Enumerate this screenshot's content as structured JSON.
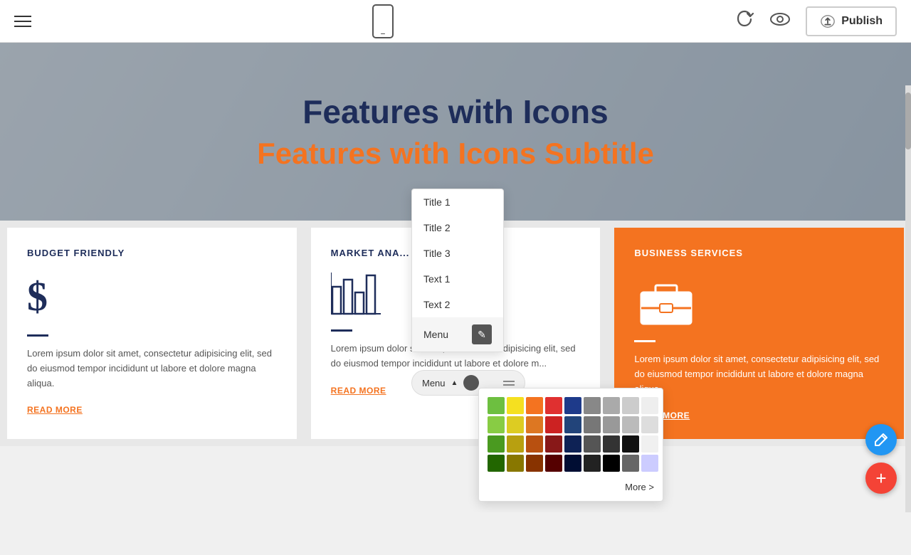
{
  "toolbar": {
    "publish_label": "Publish"
  },
  "hero": {
    "title": "Features with Icons",
    "subtitle": "Features with Icons Subtitle"
  },
  "cards": [
    {
      "id": "budget",
      "title": "BUDGET FRIENDLY",
      "icon_type": "dollar",
      "text": "Lorem ipsum dolor sit amet, consectetur adipisicing elit, sed do eiusmod tempor incididunt ut labore et dolore magna aliqua.",
      "link": "READ MORE",
      "orange": false
    },
    {
      "id": "market",
      "title": "MARKET ANA...",
      "icon_type": "chart",
      "text": "Lorem ipsum dolor sit amet, consectetur adipisicing elit, sed do eiusmod tempor incididunt ut labore et dolore m...",
      "link": "READ MORE",
      "orange": false
    },
    {
      "id": "business",
      "title": "BUSINESS SERVICES",
      "icon_type": "briefcase",
      "text": "Lorem ipsum dolor sit amet, consectetur adipisicing elit, sed do eiusmod tempor incididunt ut labore et dolore magna aliqua.",
      "link": "READ MORE",
      "orange": true
    }
  ],
  "dropdown": {
    "items": [
      {
        "label": "Title 1"
      },
      {
        "label": "Title 2"
      },
      {
        "label": "Title 3"
      },
      {
        "label": "Text 1"
      },
      {
        "label": "Text 2"
      },
      {
        "label": "Menu"
      }
    ]
  },
  "menu_bar": {
    "label": "Menu"
  },
  "color_palette": {
    "colors": [
      "#6dbf40",
      "#f5e020",
      "#f47320",
      "#e03030",
      "#1e3a8a",
      "#888888",
      "#aaaaaa",
      "#cccccc",
      "#eeeeee",
      "#88cc44",
      "#ddcc22",
      "#dd7722",
      "#cc2222",
      "#22447a",
      "#777777",
      "#999999",
      "#bbbbbb",
      "#dddddd",
      "#4a9a20",
      "#b8a010",
      "#b85010",
      "#881818",
      "#0e2255",
      "#555555",
      "#333333",
      "#111111",
      "#f0f0f0",
      "#226600",
      "#887700",
      "#883300",
      "#550000",
      "#000d33",
      "#222222",
      "#000000",
      "#666666",
      "#ccccff"
    ],
    "more_label": "More >"
  },
  "fab": {
    "pen_icon": "✎",
    "plus_icon": "+"
  }
}
